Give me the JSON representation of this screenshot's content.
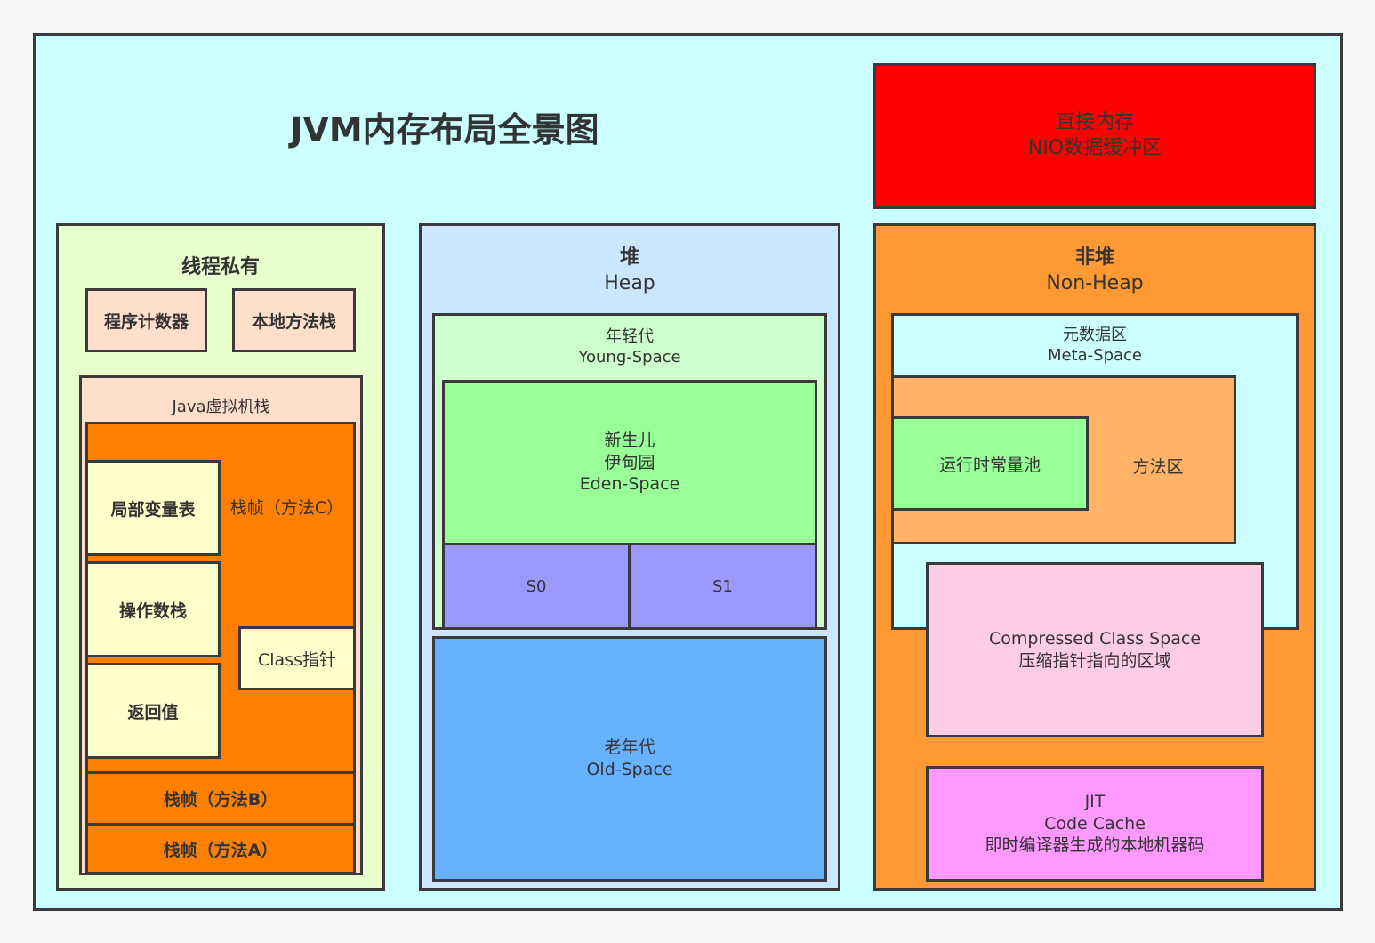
{
  "title": "JVM内存布局全景图",
  "direct_memory": {
    "line1": "直接内存",
    "line2": "NIO数据缓冲区"
  },
  "thread_private": {
    "title": "线程私有",
    "pc": "程序计数器",
    "native_stack": "本地方法栈",
    "java_stack": "Java虚拟机栈",
    "frame_c": "栈帧（方法C）",
    "local_vars": "局部变量表",
    "operand_stack": "操作数栈",
    "return_value": "返回值",
    "class_pointer": "Class指针",
    "frame_b": "栈帧（方法B）",
    "frame_a": "栈帧（方法A）"
  },
  "heap": {
    "title_cn": "堆",
    "title_en": "Heap",
    "young_cn": "年轻代",
    "young_en": "Young-Space",
    "eden_line1": "新生儿",
    "eden_line2": "伊甸园",
    "eden_line3": "Eden-Space",
    "s0": "S0",
    "s1": "S1",
    "old_cn": "老年代",
    "old_en": "Old-Space"
  },
  "non_heap": {
    "title_cn": "非堆",
    "title_en": "Non-Heap",
    "meta_cn": "元数据区",
    "meta_en": "Meta-Space",
    "runtime_pool": "运行时常量池",
    "method_area": "方法区",
    "ccs_line1": "Compressed Class Space",
    "ccs_line2": "压缩指针指向的区域",
    "jit_line1": "JIT",
    "jit_line2": "Code Cache",
    "jit_line3": "即时编译器生成的本地机器码"
  },
  "colors": {
    "outer": "#ccffff",
    "thread_private": "#e6ffcc",
    "small_box": "#ffdfcc",
    "frame": "#ff8000",
    "frame_item": "#ffffcc",
    "heap": "#cce6ff",
    "young": "#ccffcc",
    "eden": "#99ff99",
    "survivor": "#9999ff",
    "old": "#66b2ff",
    "non_heap": "#ff9933",
    "meta": "#ccffff",
    "method_area": "#ffb366",
    "ccs": "#ffcce6",
    "jit": "#ff99ff",
    "direct": "#ff0000"
  }
}
